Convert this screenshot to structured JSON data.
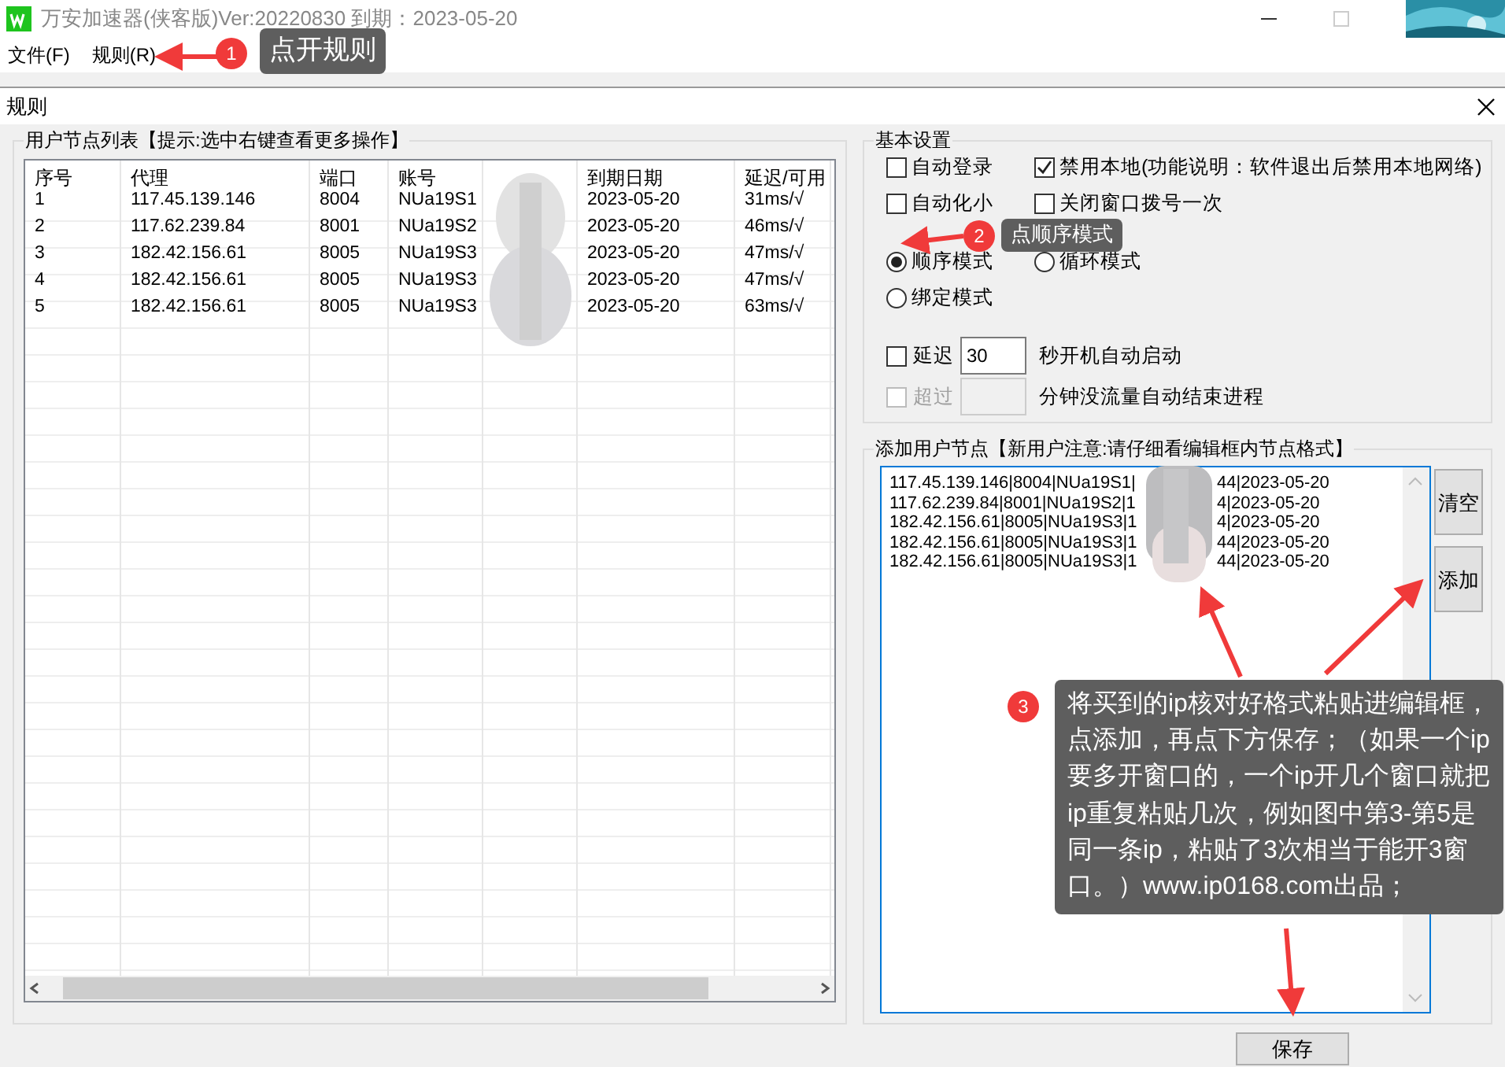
{
  "main_window": {
    "title": "万安加速器(侠客版)Ver:20220830 到期：2023-05-20",
    "menu": [
      "文件(F)",
      "规则(R)"
    ]
  },
  "dialog": {
    "title": "规则"
  },
  "node_list": {
    "title": "用户节点列表【提示:选中右键查看更多操作】",
    "columns": [
      {
        "kind": "text",
        "label": "序号"
      },
      {
        "kind": "text",
        "label": "代理"
      },
      {
        "kind": "text",
        "label": "端口"
      },
      {
        "kind": "text",
        "label": "账号"
      },
      {
        "kind": "covered"
      },
      {
        "kind": "text",
        "label": "到期日期"
      },
      {
        "kind": "text",
        "label": "延迟/可用"
      }
    ],
    "rows": [
      [
        "1",
        "117.45.139.146",
        "8004",
        "NUa19S1",
        "",
        "2023-05-20",
        "31ms/√"
      ],
      [
        "2",
        "117.62.239.84",
        "8001",
        "NUa19S2",
        "",
        "2023-05-20",
        "46ms/√"
      ],
      [
        "3",
        "182.42.156.61",
        "8005",
        "NUa19S3",
        "",
        "2023-05-20",
        "47ms/√"
      ],
      [
        "4",
        "182.42.156.61",
        "8005",
        "NUa19S3",
        "",
        "2023-05-20",
        "47ms/√"
      ],
      [
        "5",
        "182.42.156.61",
        "8005",
        "NUa19S3",
        "",
        "2023-05-20",
        "63ms/√"
      ]
    ]
  },
  "basic_settings": {
    "title": "基本设置",
    "options": [
      {
        "kind": "checkbox",
        "label": "自动登录",
        "checked": false,
        "disabled": false
      },
      {
        "kind": "checkbox",
        "label": "禁用本地(功能说明：软件退出后禁用本地网络)",
        "checked": true,
        "disabled": false
      },
      {
        "kind": "checkbox",
        "label": "自动化小",
        "checked": false,
        "disabled": false
      },
      {
        "kind": "checkbox",
        "label": "关闭窗口拨号一次",
        "checked": false,
        "disabled": false
      },
      {
        "kind": "radio",
        "label": "顺序模式",
        "selected": true
      },
      {
        "kind": "radio",
        "label": "循环模式",
        "selected": false
      },
      {
        "kind": "radio",
        "label": "绑定模式",
        "selected": false
      }
    ],
    "delay": {
      "label": "延迟",
      "checked": false,
      "disabled": false,
      "value": "30",
      "suffix": "秒开机自动启动"
    },
    "timeout": {
      "label": "超过",
      "checked": false,
      "disabled": true,
      "suffix": "分钟没流量自动结束进程"
    }
  },
  "add_nodes": {
    "title": "添加用户节点【新用户注意:请仔细看编辑框内节点格式】",
    "lines": [
      {
        "before": "117.45.139.146|8004|NUa19S1|",
        "after": "44|2023-05-20"
      },
      {
        "before": "117.62.239.84|8001|NUa19S2|1",
        "after": "4|2023-05-20"
      },
      {
        "before": "182.42.156.61|8005|NUa19S3|1",
        "after": "4|2023-05-20"
      },
      {
        "before": "182.42.156.61|8005|NUa19S3|1",
        "after": "44|2023-05-20"
      },
      {
        "before": "182.42.156.61|8005|NUa19S3|1",
        "after": "44|2023-05-20"
      }
    ],
    "buttons": [
      "清空",
      "添加"
    ]
  },
  "save_button": "保存",
  "annotations": [
    {
      "number": "1",
      "text": "点开规则"
    },
    {
      "number": "2",
      "text": "点顺序模式"
    },
    {
      "number": "3",
      "text": "将买到的ip核对好格式粘贴进编辑框，点添加，再点下方保存；（如果一个ip要多开窗口的，一个ip开几个窗口就把ip重复粘贴几次，例如图中第3-第5是同一条ip，粘贴了3次相当于能开3窗口。）www.ip0168.com出品；"
    }
  ]
}
